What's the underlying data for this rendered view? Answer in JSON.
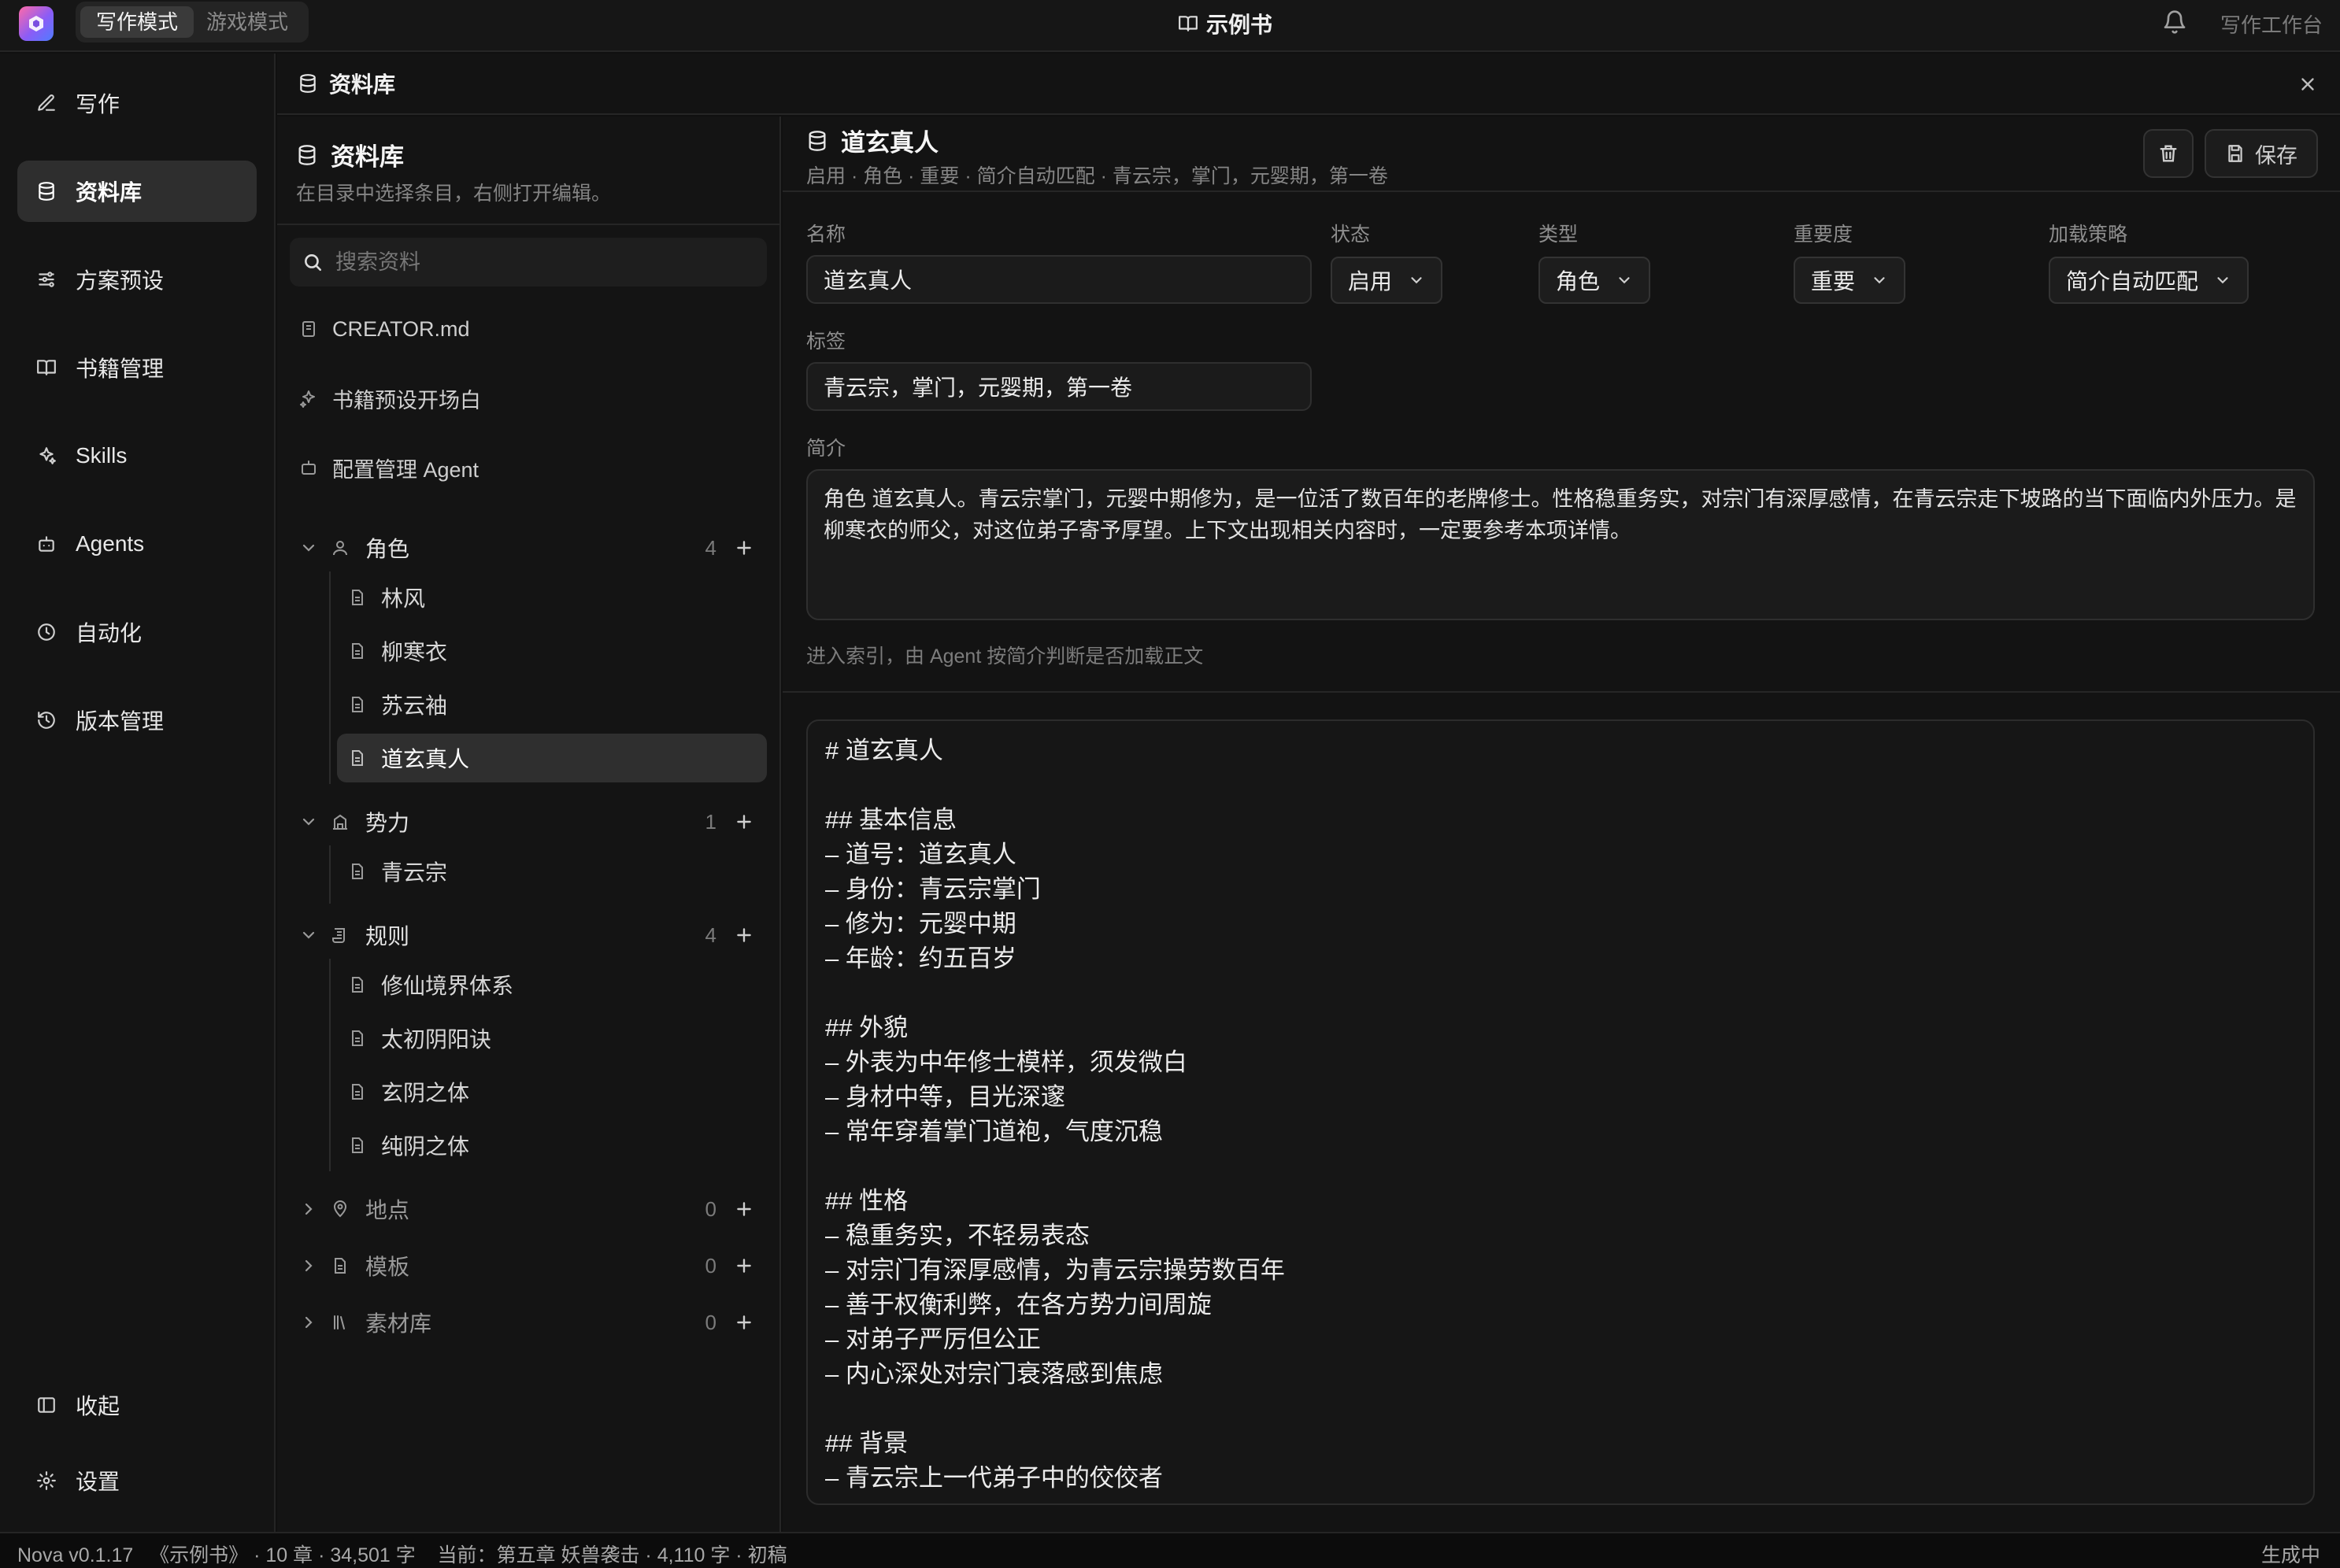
{
  "topbar": {
    "modes": [
      "写作模式",
      "游戏模式"
    ],
    "book_title": "示例书",
    "workspace": "写作工作台"
  },
  "nav": {
    "items": [
      {
        "label": "写作",
        "icon": "pencil-icon"
      },
      {
        "label": "资料库",
        "icon": "database-icon",
        "active": true
      },
      {
        "label": "方案预设",
        "icon": "sliders-icon"
      },
      {
        "label": "书籍管理",
        "icon": "book-icon"
      },
      {
        "label": "Skills",
        "icon": "sparkles-icon"
      },
      {
        "label": "Agents",
        "icon": "bot-icon"
      },
      {
        "label": "自动化",
        "icon": "clock-icon"
      },
      {
        "label": "版本管理",
        "icon": "history-icon"
      }
    ],
    "bottom": [
      {
        "label": "收起",
        "icon": "collapse-sidebar-icon"
      },
      {
        "label": "设置",
        "icon": "gear-icon"
      }
    ]
  },
  "library": {
    "header_title": "资料库",
    "panel_title": "资料库",
    "panel_subtitle": "在目录中选择条目，右侧打开编辑。",
    "search_placeholder": "搜索资料",
    "quick_items": [
      {
        "label": "CREATOR.md",
        "icon": "file-icon"
      },
      {
        "label": "书籍预设开场白",
        "icon": "sparkles-icon"
      },
      {
        "label": "配置管理 Agent",
        "icon": "bot-icon"
      }
    ],
    "groups": [
      {
        "name": "角色",
        "count": "4",
        "icon": "user-icon",
        "expanded": true,
        "items": [
          "林风",
          "柳寒衣",
          "苏云袖",
          "道玄真人"
        ],
        "active_index": 3
      },
      {
        "name": "势力",
        "count": "1",
        "icon": "building-icon",
        "expanded": true,
        "items": [
          "青云宗"
        ]
      },
      {
        "name": "规则",
        "count": "4",
        "icon": "scroll-icon",
        "expanded": true,
        "items": [
          "修仙境界体系",
          "太初阴阳诀",
          "玄阴之体",
          "纯阴之体"
        ]
      },
      {
        "name": "地点",
        "count": "0",
        "icon": "map-pin-icon",
        "expanded": false,
        "items": []
      },
      {
        "name": "模板",
        "count": "0",
        "icon": "template-icon",
        "expanded": false,
        "items": []
      },
      {
        "name": "素材库",
        "count": "0",
        "icon": "library-icon",
        "expanded": false,
        "items": []
      }
    ]
  },
  "editor": {
    "title": "道玄真人",
    "meta": "启用 · 角色 · 重要 · 简介自动匹配 · 青云宗，掌门，元婴期，第一卷",
    "save_label": "保存",
    "fields": {
      "name_label": "名称",
      "name_value": "道玄真人",
      "status_label": "状态",
      "status_value": "启用",
      "type_label": "类型",
      "type_value": "角色",
      "importance_label": "重要度",
      "importance_value": "重要",
      "strategy_label": "加载策略",
      "strategy_value": "简介自动匹配",
      "tags_label": "标签",
      "tags_value": "青云宗，掌门，元婴期，第一卷",
      "summary_label": "简介",
      "summary_value": "角色 道玄真人。青云宗掌门，元婴中期修为，是一位活了数百年的老牌修士。性格稳重务实，对宗门有深厚感情，在青云宗走下坡路的当下面临内外压力。是柳寒衣的师父，对这位弟子寄予厚望。上下文出现相关内容时，一定要参考本项详情。"
    },
    "hint": "进入索引，由 Agent 按简介判断是否加载正文",
    "markdown_lines": [
      "# 道玄真人",
      "",
      "## 基本信息",
      "– 道号：道玄真人",
      "– 身份：青云宗掌门",
      "– 修为：元婴中期",
      "– 年龄：约五百岁",
      "",
      "## 外貌",
      "– 外表为中年修士模样，须发微白",
      "– 身材中等，目光深邃",
      "– 常年穿着掌门道袍，气度沉稳",
      "",
      "## 性格",
      "– 稳重务实，不轻易表态",
      "– 对宗门有深厚感情，为青云宗操劳数百年",
      "– 善于权衡利弊，在各方势力间周旋",
      "– 对弟子严厉但公正",
      "– 内心深处对宗门衰落感到焦虑",
      "",
      "## 背景",
      "– 青云宗上一代弟子中的佼佼者"
    ]
  },
  "statusbar": {
    "left": "Nova v0.1.17   《示例书》 · 10 章 · 34,501 字    当前：第五章 妖兽袭击 · 4,110 字 · 初稿",
    "right": "生成中"
  }
}
